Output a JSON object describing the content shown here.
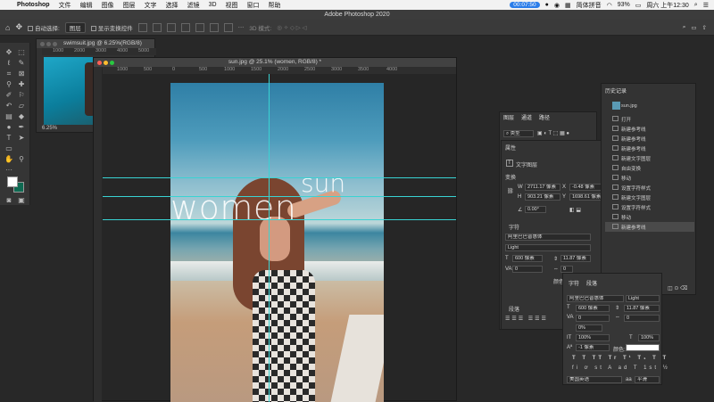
{
  "menubar": {
    "apple": "",
    "app": "Photoshop",
    "items": [
      "文件",
      "编辑",
      "图像",
      "图层",
      "文字",
      "选择",
      "滤镜",
      "3D",
      "视图",
      "窗口",
      "帮助"
    ],
    "timer": "00:07:50",
    "ime": "简体拼音",
    "battery": "93%",
    "clock": "周六 上午12:30"
  },
  "titlebar": {
    "title": "Adobe Photoshop 2020"
  },
  "options": {
    "auto_select_label": "自动选择:",
    "auto_select_value": "图层",
    "show_transform_label": "显示变换控件",
    "mode_3d": "3D 模式:"
  },
  "doc1": {
    "title": "swimsuit.jpg @ 6.25%(RGB/8)",
    "zoom": "6.25%",
    "ruler": [
      "1000",
      "2000",
      "3000",
      "4000",
      "5000"
    ]
  },
  "doc2": {
    "title": "sun.jpg @ 25.1% (women, RGB/8) *",
    "ruler": [
      "1000",
      "500",
      "0",
      "500",
      "1000",
      "1500",
      "2000",
      "2500",
      "3000",
      "3500",
      "4000"
    ],
    "text_women": "women",
    "text_sun": "sun"
  },
  "layers_panel": {
    "tabs": [
      "图层",
      "通道",
      "路径"
    ],
    "filter_label": "类型"
  },
  "properties": {
    "title": "属性",
    "layer_type": "文字图层",
    "transform_title": "变换",
    "w_label": "W",
    "w_value": "2711.17 像素",
    "x_label": "X",
    "x_value": "-0.48 像素",
    "h_label": "H",
    "h_value": "903.21 像素",
    "y_label": "Y",
    "y_value": "1698.61 像素",
    "angle": "0.00°",
    "char_title": "字符",
    "font_family": "阿里巴巴普惠体",
    "font_style": "Light",
    "font_size": "600 像素",
    "leading": "11.87 像素",
    "tracking": "0",
    "kerning": "0",
    "color_label": "颜色:",
    "para_title": "段落"
  },
  "history": {
    "title": "历史记录",
    "snapshot": "sun.jpg",
    "items": [
      "打开",
      "新建参考线",
      "新建参考线",
      "新建参考线",
      "新建文字图层",
      "自由变换",
      "移动",
      "设置字符样式",
      "新建文字图层",
      "设置字符样式",
      "移动",
      "新建参考线"
    ]
  },
  "character": {
    "tabs": [
      "字符",
      "段落"
    ],
    "font_family": "阿里巴巴普惠体",
    "font_style": "Light",
    "font_size": "600 像素",
    "leading": "11.87 像素",
    "kerning": "0",
    "tracking": "0",
    "percent": "0%",
    "vscale": "100%",
    "hscale": "100%",
    "baseline": "-1 像素",
    "color_label": "颜色:",
    "language": "美国英语",
    "aa_label": "aa",
    "aa_value": "平滑"
  },
  "colors": {
    "accent": "#2b7de9",
    "guide": "#39d3d3",
    "fg_swatch": "#ffffff",
    "bg_swatch": "#0f6a52"
  }
}
